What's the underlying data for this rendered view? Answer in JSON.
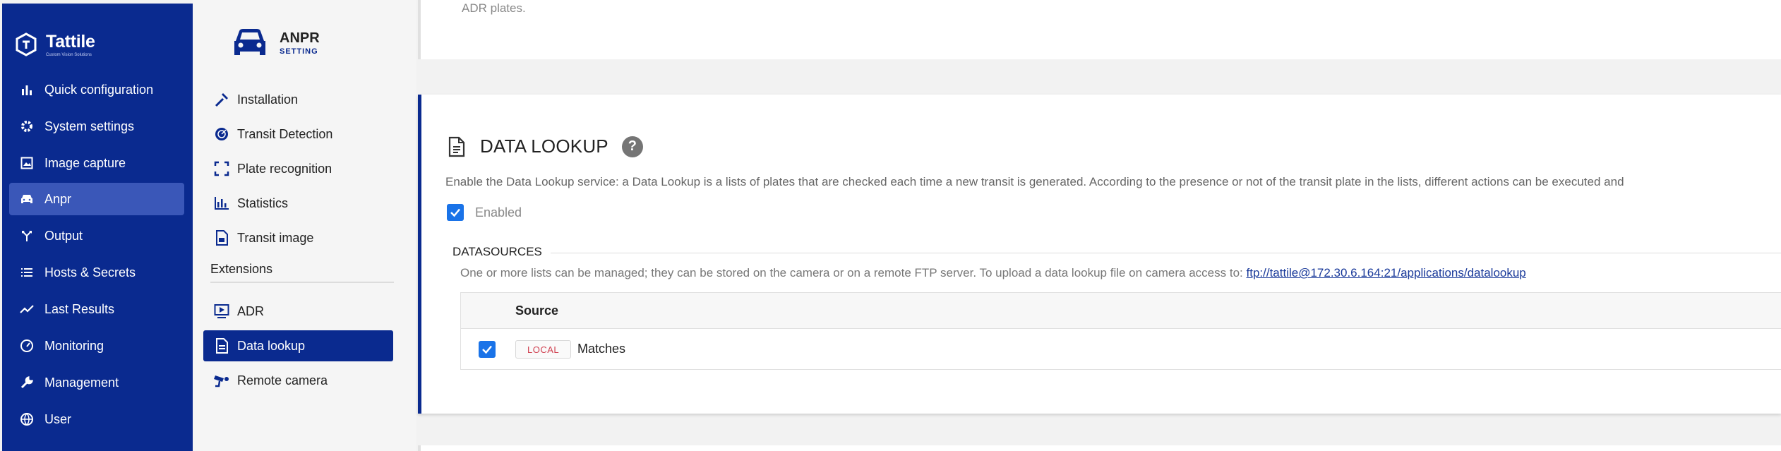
{
  "brand": {
    "name": "Tattile",
    "tagline": "Custom Vision Solutions"
  },
  "nav": {
    "items": [
      {
        "label": "Quick configuration",
        "icon": "bar-chart-icon"
      },
      {
        "label": "System settings",
        "icon": "gear-icon"
      },
      {
        "label": "Image capture",
        "icon": "image-icon"
      },
      {
        "label": "Anpr",
        "icon": "car-icon"
      },
      {
        "label": "Output",
        "icon": "split-arrow-icon"
      },
      {
        "label": "Hosts & Secrets",
        "icon": "list-icon"
      },
      {
        "label": "Last Results",
        "icon": "trend-line-icon"
      },
      {
        "label": "Monitoring",
        "icon": "gauge-icon"
      },
      {
        "label": "Management",
        "icon": "wrench-icon"
      },
      {
        "label": "User",
        "icon": "globe-icon"
      }
    ],
    "active": "Anpr"
  },
  "anpr": {
    "title": "ANPR",
    "subtitle": "SETTING"
  },
  "menu": {
    "items": [
      {
        "label": "Installation",
        "icon": "hammer-icon"
      },
      {
        "label": "Transit Detection",
        "icon": "radar-icon"
      },
      {
        "label": "Plate recognition",
        "icon": "focus-frame-icon"
      },
      {
        "label": "Statistics",
        "icon": "statistics-icon"
      },
      {
        "label": "Transit image",
        "icon": "document-image-icon"
      }
    ],
    "section": "Extensions",
    "extensions": [
      {
        "label": "ADR",
        "icon": "play-screen-icon"
      },
      {
        "label": "Data lookup",
        "icon": "document-icon"
      },
      {
        "label": "Remote camera",
        "icon": "camera-icon"
      }
    ],
    "active": "Data lookup"
  },
  "top_card": {
    "text": "ADR plates."
  },
  "data_lookup": {
    "title": "DATA LOOKUP",
    "help": "?",
    "description": "Enable the Data Lookup service: a Data Lookup is a lists of plates that are checked each time a new transit is generated. According to the presence or not of the transit plate in the lists, different actions can be executed and",
    "enabled_label": "Enabled",
    "enabled": true
  },
  "datasources": {
    "legend": "DATASOURCES",
    "description": "One or more lists can be managed; they can be stored on the camera or on a remote FTP server. To upload a data lookup file on camera access to:",
    "link": "ftp://tattile@172.30.6.164:21/applications/datalookup",
    "column_header": "Source",
    "rows": [
      {
        "checked": true,
        "chip": "LOCAL",
        "name": "Matches"
      }
    ]
  },
  "colors": {
    "nav_bg": "#0a2a8f",
    "accent": "#1a73e8",
    "chip_text": "#d04050"
  }
}
